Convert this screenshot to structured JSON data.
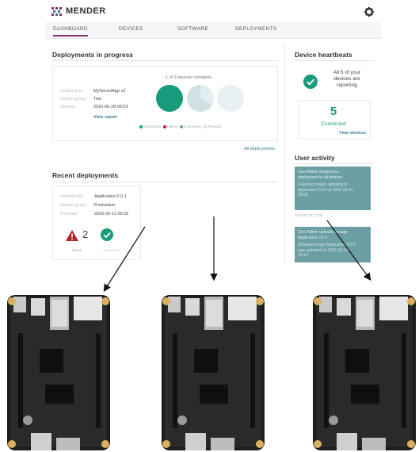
{
  "app": {
    "name": "MENDER"
  },
  "nav": {
    "items": [
      "DASHBOARD",
      "DEVICES",
      "SOFTWARE",
      "DEPLOYMENTS"
    ]
  },
  "in_progress": {
    "title": "Deployments in progress",
    "updating_label": "Updating to:",
    "updating_value": "MySecretApp v2",
    "group_label": "Device group:",
    "group_value": "Test",
    "started_label": "Started:",
    "started_value": "2016-06-28 06:03",
    "view_report": "View report",
    "complete_text": "1 of 3 devices complete",
    "legend": [
      "Successful",
      "Failed",
      "In progress",
      "Pending"
    ],
    "all_link": "All deployments"
  },
  "recent": {
    "title": "Recent deployments",
    "updating_label": "Updating to:",
    "updating_value": "Application 0.0.1",
    "group_label": "Device group:",
    "group_value": "Production",
    "finished_label": "Finished:",
    "finished_value": "2016-03-11 05:03",
    "failed_count": "2",
    "failed_label": "Failed",
    "success_label": "Successful"
  },
  "heartbeat": {
    "title": "Device heartbeats",
    "line1": "All 5 of your",
    "line2": "devices are",
    "line3": "reporting",
    "connected_count": "5",
    "connected_label": "Connected",
    "view_devices": "View devices"
  },
  "activity": {
    "title": "User activity",
    "card1_line1": "User Admin deployed a",
    "card1_line2": "deployment to all devices",
    "card1_line3": "6 devices began updating to",
    "card1_line4": "Application 0.0.2 at 2016-03-24",
    "card1_line5": "00:00",
    "timestamp": "2016-03-21 17:00",
    "card2_line1": "User Admin uploaded image",
    "card2_line2": "Application 0.0.2",
    "card2_line3": "Software image Application 0.0.2",
    "card2_line4": "was uploaded at 2016-03-24",
    "card2_line5": "15:13"
  },
  "colors": {
    "brand": "#8e2d6b",
    "success": "#1a9a7c",
    "fail": "#b0232a",
    "accent": "#36808c"
  }
}
